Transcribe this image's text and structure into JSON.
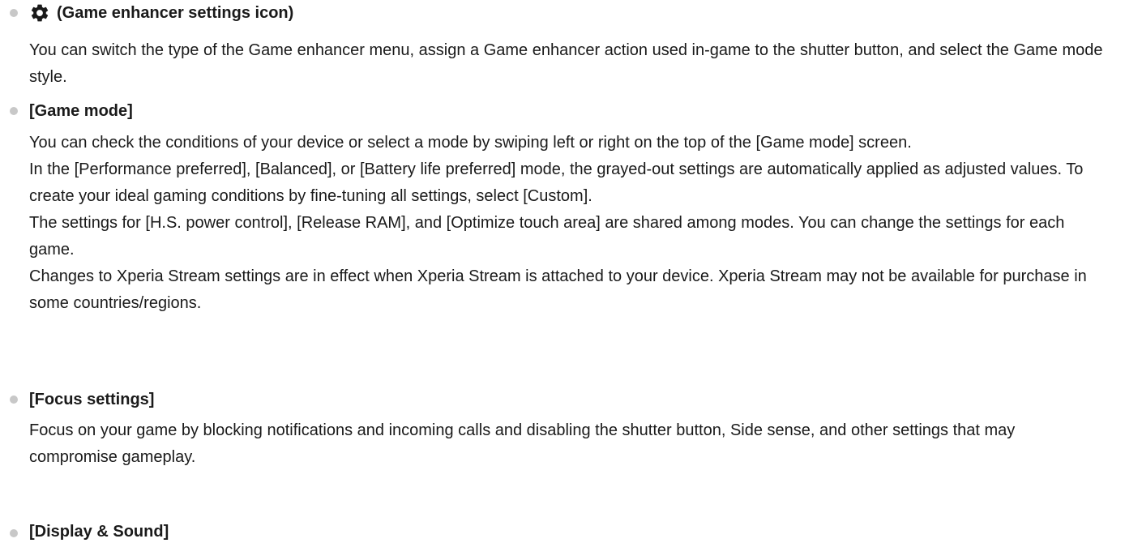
{
  "items": [
    {
      "heading": "(Game enhancer settings icon)",
      "icon": "gear-icon",
      "paragraphs": [
        "You can switch the type of the Game enhancer menu, assign a Game enhancer action used in-game to the shutter button, and select the Game mode style."
      ]
    },
    {
      "heading": "[Game mode]",
      "paragraphs": [
        "You can check the conditions of your device or select a mode by swiping left or right on the top of the [Game mode] screen.",
        "In the [Performance preferred], [Balanced], or [Battery life preferred] mode, the grayed-out settings are automatically applied as adjusted values. To create your ideal gaming conditions by fine-tuning all settings, select [Custom].",
        "The settings for [H.S. power control], [Release RAM], and [Optimize touch area] are shared among modes. You can change the settings for each game.",
        "Changes to Xperia Stream settings are in effect when Xperia Stream is attached to your device. Xperia Stream may not be available for purchase in some countries/regions."
      ]
    },
    {
      "heading": "[Focus settings]",
      "paragraphs": [
        "Focus on your game by blocking notifications and incoming calls and disabling the shutter button, Side sense, and other settings that may compromise gameplay."
      ]
    },
    {
      "heading": "[Display & Sound]",
      "paragraphs": []
    }
  ]
}
